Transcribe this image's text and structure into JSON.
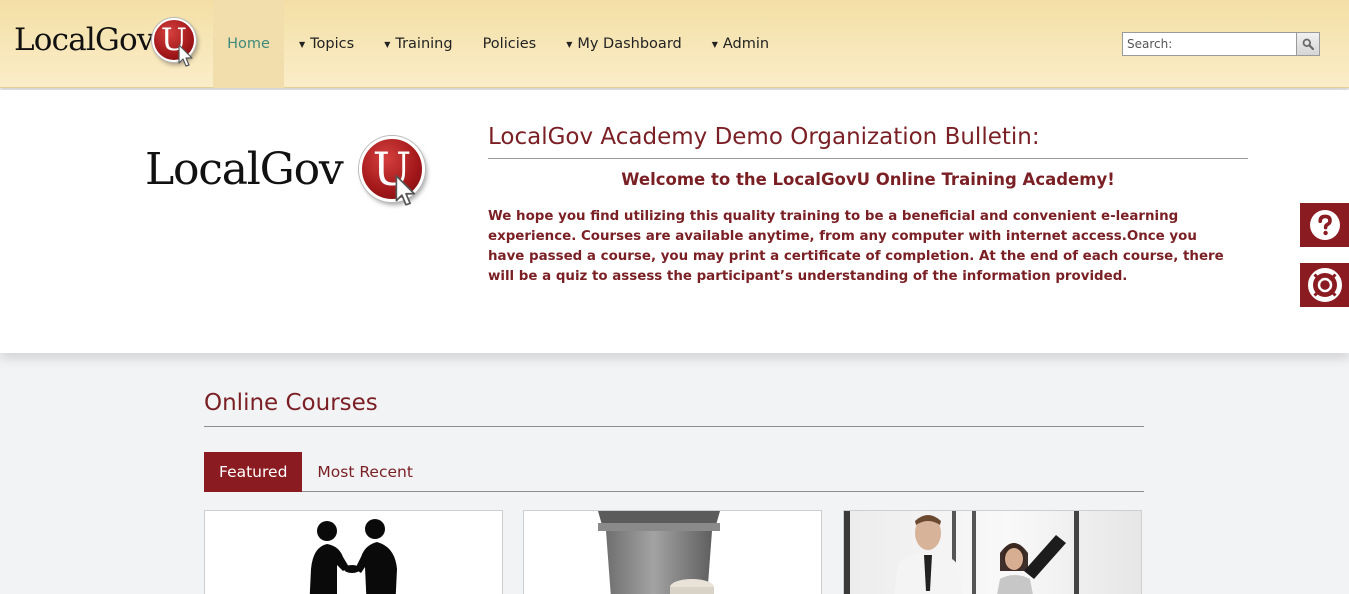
{
  "header": {
    "logo_text": "LocalGov",
    "logo_badge": "U",
    "nav": [
      {
        "label": "Home",
        "active": true,
        "dropdown": false
      },
      {
        "label": "Topics",
        "active": false,
        "dropdown": true
      },
      {
        "label": "Training",
        "active": false,
        "dropdown": true
      },
      {
        "label": "Policies",
        "active": false,
        "dropdown": false
      },
      {
        "label": "My Dashboard",
        "active": false,
        "dropdown": true
      },
      {
        "label": "Admin",
        "active": false,
        "dropdown": true
      }
    ],
    "caret_glyph": "▼",
    "search": {
      "placeholder": "Search:",
      "icon": "search-icon"
    }
  },
  "hero": {
    "logo_text": "LocalGov",
    "logo_badge": "U",
    "bulletin_title": "LocalGov Academy Demo Organization Bulletin:",
    "welcome": "Welcome to the LocalGovU Online Training Academy!",
    "body": "We hope you find utilizing this quality training to be a beneficial and convenient e-learning experience. Courses are available anytime, from any computer with internet access.Once you have passed a course, you may print a certificate of completion.  At the end of each course, there will be a quiz to assess the participant’s understanding of the information provided."
  },
  "side_buttons": {
    "help_icon": "question-circle-icon",
    "support_icon": "life-ring-icon"
  },
  "courses": {
    "title": "Online Courses",
    "tabs": [
      {
        "label": "Featured",
        "active": true
      },
      {
        "label": "Most Recent",
        "active": false
      }
    ],
    "cards": [
      {
        "image": "handshake-silhouette-image"
      },
      {
        "image": "trash-can-image"
      },
      {
        "image": "office-workers-image"
      }
    ]
  },
  "colors": {
    "brand_red": "#8a1b21",
    "text_red": "#7a1f24",
    "header_gold": "#f3dfa5",
    "home_active_text": "#3f8a7a"
  }
}
